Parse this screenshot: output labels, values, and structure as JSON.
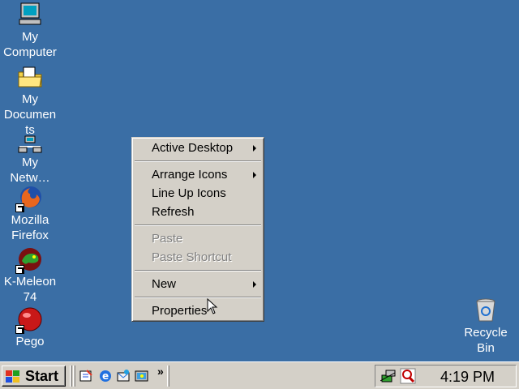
{
  "desktop": {
    "icons": [
      {
        "label": "My\nComputer",
        "icon": "my-computer-icon"
      },
      {
        "label": "My\nDocumen\nts",
        "icon": "my-documents-icon"
      },
      {
        "label": "My\nNetw…",
        "icon": "network-icon"
      },
      {
        "label": "Mozilla\nFirefox",
        "icon": "firefox-icon"
      },
      {
        "label": "K-Meleon\n74",
        "icon": "k-meleon-icon"
      },
      {
        "label": "Pego",
        "icon": "pego-icon"
      },
      {
        "label": "Recycle\nBin",
        "icon": "recycle-bin-icon"
      }
    ],
    "background_color": "#3a6ea5"
  },
  "context_menu": {
    "active_desktop": "Active Desktop",
    "arrange_icons": "Arrange Icons",
    "line_up_icons": "Line Up Icons",
    "refresh": "Refresh",
    "paste": "Paste",
    "paste_shortcut": "Paste Shortcut",
    "new": "New",
    "properties": "Properties"
  },
  "taskbar": {
    "start_label": "Start",
    "quick_launch_overflow": "»",
    "clock": "4:19 PM"
  }
}
